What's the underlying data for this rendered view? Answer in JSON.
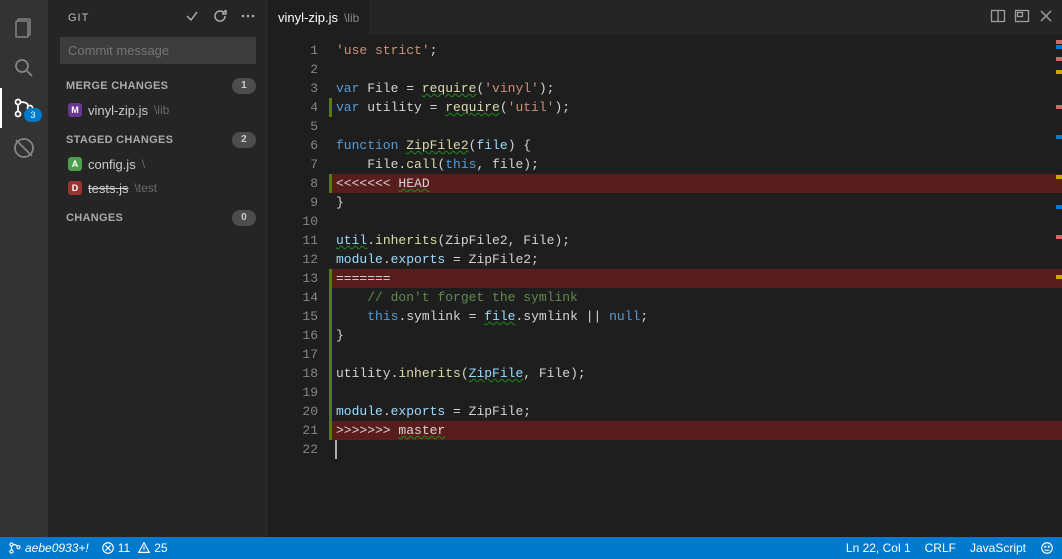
{
  "sidebar": {
    "title": "GIT",
    "commit_placeholder": "Commit message",
    "scm_badge": "3",
    "sections": {
      "merge": {
        "label": "MERGE CHANGES",
        "count": "1",
        "items": [
          {
            "badge": "M",
            "name": "vinyl-zip.js",
            "path": "\\lib"
          }
        ]
      },
      "staged": {
        "label": "STAGED CHANGES",
        "count": "2",
        "items": [
          {
            "badge": "A",
            "name": "config.js",
            "path": "\\"
          },
          {
            "badge": "D",
            "name": "tests.js",
            "path": "\\test",
            "strike": true
          }
        ]
      },
      "changes": {
        "label": "CHANGES",
        "count": "0",
        "items": []
      }
    }
  },
  "editor": {
    "tab_name": "vinyl-zip.js",
    "tab_path": "\\lib",
    "lines": [
      {
        "n": 1,
        "seg": [
          {
            "t": "'use strict'",
            "c": "tok-str"
          },
          {
            "t": ";",
            "c": "tok-plain"
          }
        ]
      },
      {
        "n": 2,
        "seg": []
      },
      {
        "n": 3,
        "seg": [
          {
            "t": "var",
            "c": "tok-kw"
          },
          {
            "t": " File = ",
            "c": "tok-plain"
          },
          {
            "t": "require",
            "c": "tok-fn",
            "sq": true
          },
          {
            "t": "(",
            "c": "tok-plain"
          },
          {
            "t": "'vinyl'",
            "c": "tok-str"
          },
          {
            "t": ");",
            "c": "tok-plain"
          }
        ]
      },
      {
        "n": 4,
        "add": true,
        "seg": [
          {
            "t": "var",
            "c": "tok-kw"
          },
          {
            "t": " utility = ",
            "c": "tok-plain"
          },
          {
            "t": "require",
            "c": "tok-fn",
            "sq": true
          },
          {
            "t": "(",
            "c": "tok-plain"
          },
          {
            "t": "'util'",
            "c": "tok-str"
          },
          {
            "t": ");",
            "c": "tok-plain"
          }
        ]
      },
      {
        "n": 5,
        "seg": []
      },
      {
        "n": 6,
        "seg": [
          {
            "t": "function",
            "c": "tok-kw"
          },
          {
            "t": " ",
            "c": "tok-plain"
          },
          {
            "t": "ZipFile2",
            "c": "tok-fn",
            "sq": true
          },
          {
            "t": "(",
            "c": "tok-plain"
          },
          {
            "t": "file",
            "c": "tok-var"
          },
          {
            "t": ") {",
            "c": "tok-plain"
          }
        ]
      },
      {
        "n": 7,
        "seg": [
          {
            "t": "    File.",
            "c": "tok-plain"
          },
          {
            "t": "call",
            "c": "tok-fn"
          },
          {
            "t": "(",
            "c": "tok-plain"
          },
          {
            "t": "this",
            "c": "tok-kw"
          },
          {
            "t": ", file);",
            "c": "tok-plain"
          }
        ]
      },
      {
        "n": 8,
        "conflict": true,
        "add": true,
        "seg": [
          {
            "t": "<<<<<<< ",
            "c": "tok-plain"
          },
          {
            "t": "HEAD",
            "c": "tok-plain",
            "sq": true
          }
        ]
      },
      {
        "n": 9,
        "seg": [
          {
            "t": "}",
            "c": "tok-plain"
          }
        ]
      },
      {
        "n": 10,
        "seg": []
      },
      {
        "n": 11,
        "seg": [
          {
            "t": "util",
            "c": "tok-var",
            "sq": true
          },
          {
            "t": ".",
            "c": "tok-plain"
          },
          {
            "t": "inherits",
            "c": "tok-fn"
          },
          {
            "t": "(ZipFile2, File);",
            "c": "tok-plain"
          }
        ]
      },
      {
        "n": 12,
        "seg": [
          {
            "t": "module",
            "c": "tok-var"
          },
          {
            "t": ".",
            "c": "tok-plain"
          },
          {
            "t": "exports",
            "c": "tok-var"
          },
          {
            "t": " = ZipFile2;",
            "c": "tok-plain"
          }
        ]
      },
      {
        "n": 13,
        "conflict": true,
        "add": true,
        "seg": [
          {
            "t": "=======",
            "c": "tok-plain"
          }
        ]
      },
      {
        "n": 14,
        "add": true,
        "seg": [
          {
            "t": "    ",
            "c": "tok-plain"
          },
          {
            "t": "// don't forget the symlink",
            "c": "tok-comment"
          }
        ]
      },
      {
        "n": 15,
        "add": true,
        "seg": [
          {
            "t": "    ",
            "c": "tok-plain"
          },
          {
            "t": "this",
            "c": "tok-kw"
          },
          {
            "t": ".symlink = ",
            "c": "tok-plain"
          },
          {
            "t": "file",
            "c": "tok-var",
            "sq": true
          },
          {
            "t": ".symlink || ",
            "c": "tok-plain"
          },
          {
            "t": "null",
            "c": "tok-kw"
          },
          {
            "t": ";",
            "c": "tok-plain"
          }
        ]
      },
      {
        "n": 16,
        "add": true,
        "seg": [
          {
            "t": "}",
            "c": "tok-plain"
          }
        ]
      },
      {
        "n": 17,
        "add": true,
        "seg": []
      },
      {
        "n": 18,
        "add": true,
        "seg": [
          {
            "t": "utility.",
            "c": "tok-plain"
          },
          {
            "t": "inherits",
            "c": "tok-fn"
          },
          {
            "t": "(",
            "c": "tok-plain"
          },
          {
            "t": "ZipFile",
            "c": "tok-var",
            "sq": true
          },
          {
            "t": ", File);",
            "c": "tok-plain"
          }
        ]
      },
      {
        "n": 19,
        "add": true,
        "seg": []
      },
      {
        "n": 20,
        "add": true,
        "seg": [
          {
            "t": "module",
            "c": "tok-var"
          },
          {
            "t": ".",
            "c": "tok-plain"
          },
          {
            "t": "exports",
            "c": "tok-var"
          },
          {
            "t": " = ZipFile;",
            "c": "tok-plain"
          }
        ]
      },
      {
        "n": 21,
        "conflict": true,
        "add": true,
        "seg": [
          {
            "t": ">>>>>>> ",
            "c": "tok-plain"
          },
          {
            "t": "master",
            "c": "tok-plain",
            "sq": true
          }
        ]
      },
      {
        "n": 22,
        "seg": [],
        "cursor": true
      }
    ]
  },
  "status": {
    "branch": "aebe0933+!",
    "errors": "11",
    "warnings": "25",
    "cursor": "Ln 22, Col 1",
    "eol": "CRLF",
    "lang": "JavaScript"
  }
}
